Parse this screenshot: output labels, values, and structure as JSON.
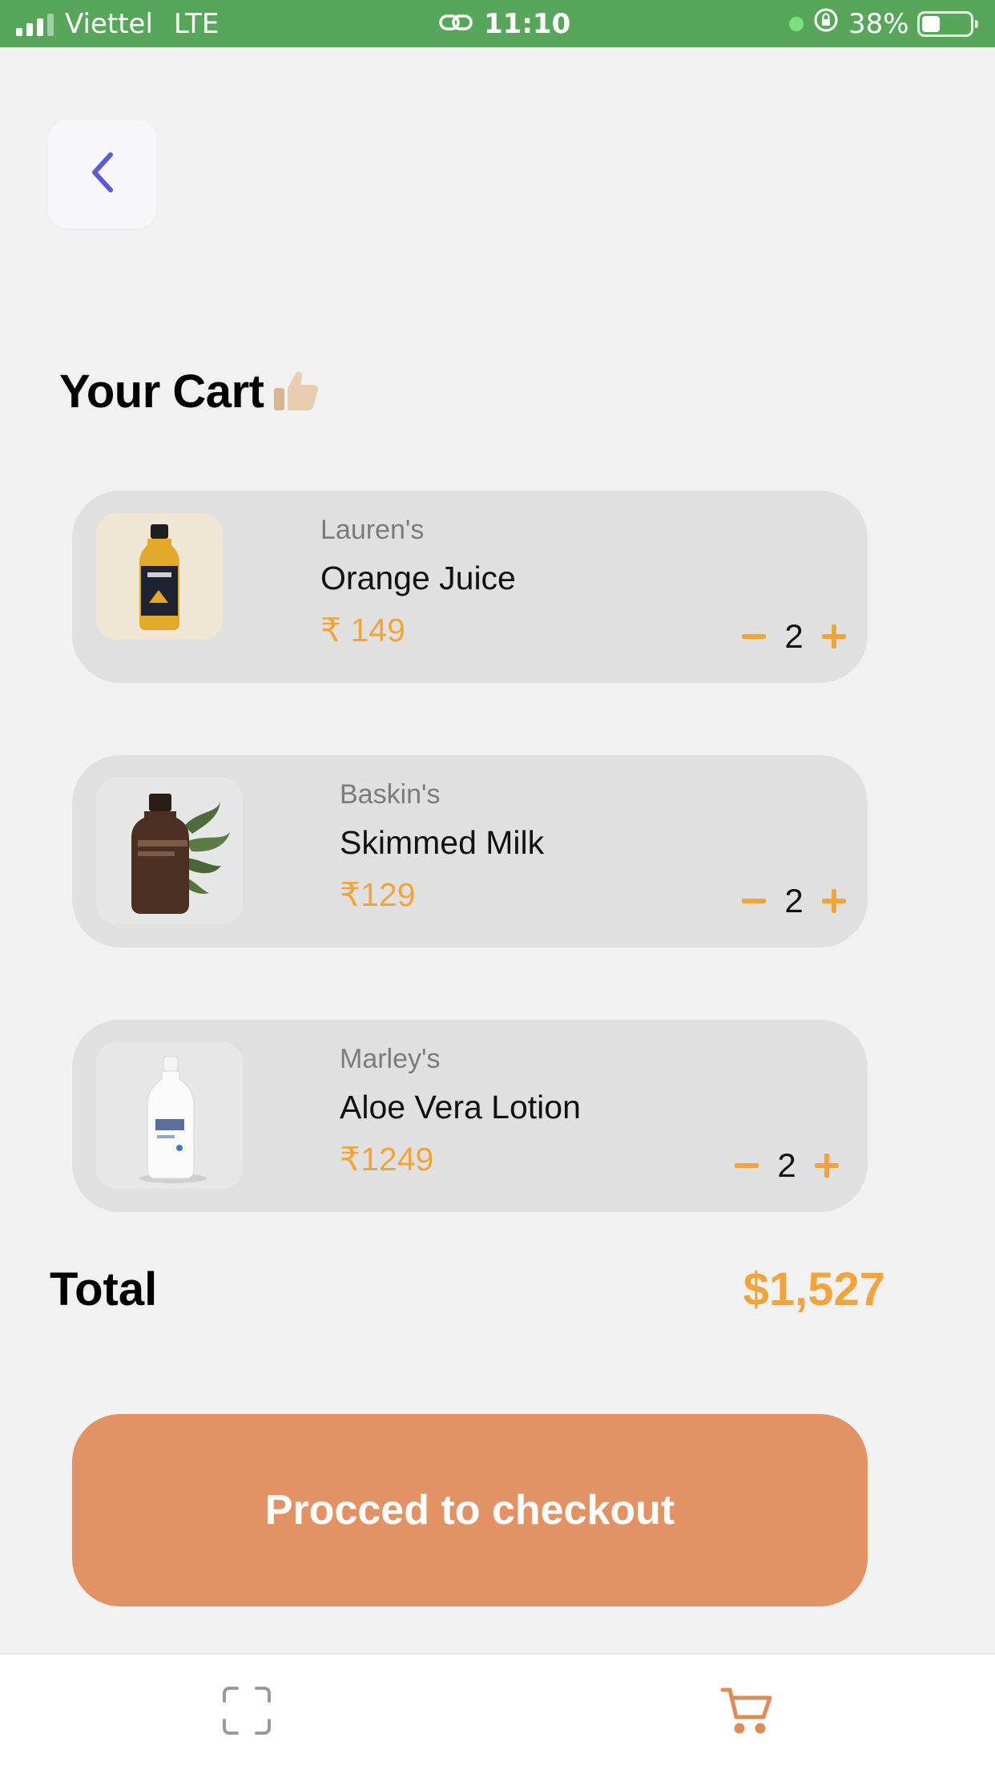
{
  "status_bar": {
    "carrier": "Viettel",
    "network": "LTE",
    "time": "11:10",
    "battery_percent_label": "38%",
    "battery_level": 0.38
  },
  "page": {
    "title": "Your Cart",
    "title_icon": "thumbs-up-icon"
  },
  "cart": {
    "items": [
      {
        "brand": "Lauren's",
        "name": "Orange Juice",
        "price": "₹ 149",
        "qty": "2",
        "image": "orange-juice-bottle"
      },
      {
        "brand": "Baskin's",
        "name": "Skimmed Milk",
        "price": "₹129",
        "qty": "2",
        "image": "amber-bottle-with-leaves"
      },
      {
        "brand": "Marley's",
        "name": "Aloe Vera Lotion",
        "price": "₹1249",
        "qty": "2",
        "image": "white-milk-bottle"
      }
    ],
    "total_label": "Total",
    "total_value": "$1,527"
  },
  "checkout": {
    "label": "Procced to checkout"
  },
  "bottom_nav": {
    "items": [
      "scan-icon",
      "cart-icon"
    ]
  },
  "colors": {
    "status_bar": "#57a65a",
    "accent_orange": "#f2a43c",
    "checkout_button": "#e29265",
    "card_bg": "#e0e0e0",
    "back_chevron": "#5b5bd6"
  }
}
